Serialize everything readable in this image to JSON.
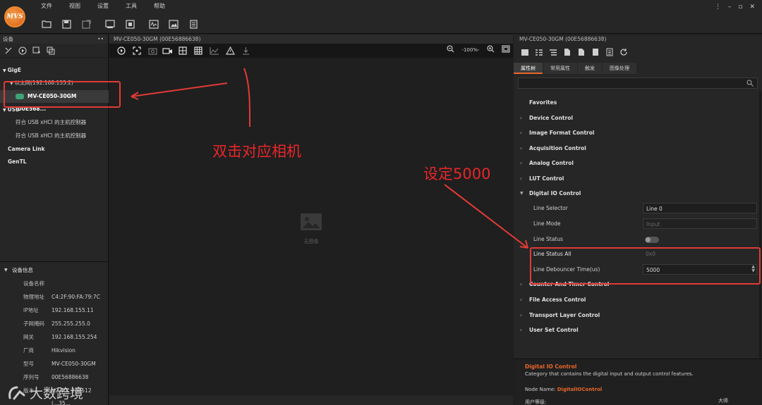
{
  "logo_text": "MVS",
  "menu": [
    "文件",
    "视图",
    "设置",
    "工具",
    "帮助"
  ],
  "window_controls": [
    "⋮",
    "–",
    "▫",
    "✕"
  ],
  "left_panel": {
    "title": "设备",
    "tree": [
      {
        "label": "GigE",
        "kind": "group"
      },
      {
        "label": "以太网(192.168.155.2)",
        "kind": "sub"
      },
      {
        "label": "MV-CE050-30GM (00E568...",
        "kind": "device"
      },
      {
        "label": "USB",
        "kind": "group"
      },
      {
        "label": "符合 USB xHCI 的主机控制器",
        "kind": "sub"
      },
      {
        "label": "符合 USB xHCI 的主机控制器",
        "kind": "sub"
      },
      {
        "label": "Camera Link",
        "kind": "group"
      },
      {
        "label": "GenTL",
        "kind": "group"
      }
    ]
  },
  "device_info": {
    "title": "设备信息",
    "rows": [
      {
        "k": "设备名称",
        "v": ""
      },
      {
        "k": "物理地址",
        "v": "C4:2F:90:FA:79:7C"
      },
      {
        "k": "IP地址",
        "v": "192.168.155.11"
      },
      {
        "k": "子网掩码",
        "v": "255.255.255.0"
      },
      {
        "k": "网关",
        "v": "192.168.155.254"
      },
      {
        "k": "厂商",
        "v": "Hikvision"
      },
      {
        "k": "型号",
        "v": "MV-CE050-30GM"
      },
      {
        "k": "序列号",
        "v": "00E56886638"
      },
      {
        "k": "版本",
        "v": "V2.4.1_200512 (...35..."
      }
    ]
  },
  "center": {
    "title": "MV-CE050-30GM (00E56886638)",
    "zoom": "-100%-",
    "no_image": "无图像"
  },
  "right_panel": {
    "title": "MV-CE050-30GM (00E56886638)",
    "tabs": [
      "属性树",
      "常用属性",
      "触发",
      "图像处理"
    ],
    "favorites": "Favorites",
    "categories_top": [
      "Device Control",
      "Image Format Control",
      "Acquisition Control",
      "Analog Control",
      "LUT Control"
    ],
    "digital_io": "Digital IO Control",
    "props": [
      {
        "k": "Line Selector",
        "v": "Line 0"
      },
      {
        "k": "Line Mode",
        "v": "Input"
      },
      {
        "k": "Line Status",
        "v": ""
      },
      {
        "k": "Line Status All",
        "v": "0x0"
      },
      {
        "k": "Line Debouncer Time(us)",
        "v": "5000"
      }
    ],
    "categories_bottom": [
      "Counter And Timer Control",
      "File Access Control",
      "Transport Layer Control",
      "User Set Control"
    ],
    "desc": {
      "title": "Digital IO Control",
      "body": "Category that contains the digital input and output control features.",
      "node_label": "Node Name: ",
      "node_name": "DigitalIOControl",
      "level_label": "用户等级:",
      "level_value": "大师"
    }
  },
  "annotations": {
    "left_note": "双击对应相机",
    "right_note": "设定5000"
  },
  "watermark": "大数跨境"
}
